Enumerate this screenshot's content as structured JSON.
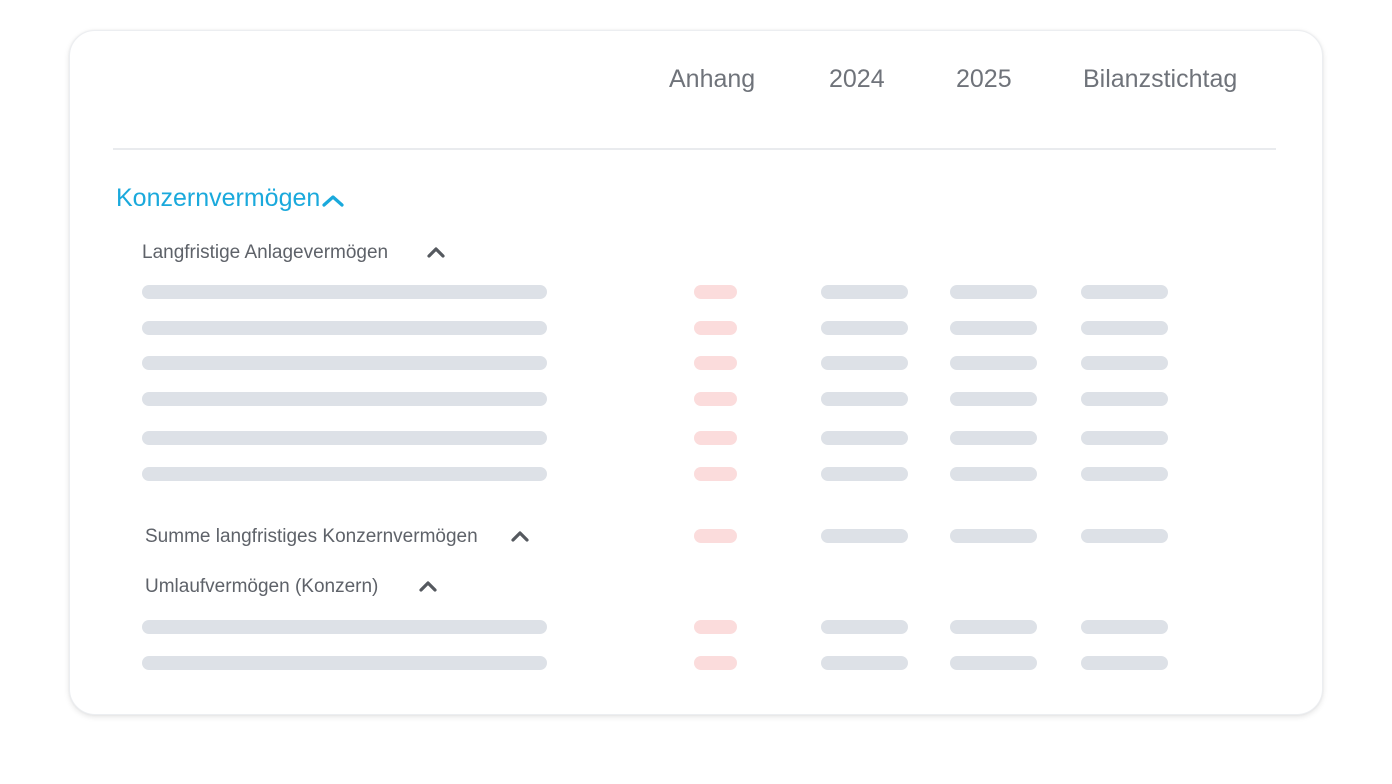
{
  "table_header": {
    "columns": [
      "Anhang",
      "2024",
      "2025",
      "Bilanzstichtag"
    ]
  },
  "section": {
    "title": "Konzernvermögen",
    "expanded": true,
    "accent_color": "#1aa9dc"
  },
  "groups": [
    {
      "label": "Langfristige Anlagevermögen",
      "expanded": true,
      "placeholder_rows": 6
    },
    {
      "label": "Summe langfristiges Konzernvermögen",
      "expanded": true,
      "placeholder_rows": 1,
      "inline_values": true
    },
    {
      "label": "Umlaufvermögen (Konzern)",
      "expanded": true,
      "placeholder_rows": 2
    }
  ],
  "icons": {
    "collapse": "chevron-up-icon"
  },
  "colors": {
    "placeholder_bar": "#dde1e7",
    "anhang_placeholder": "#fbdcdc",
    "header_text": "#6f737a"
  }
}
